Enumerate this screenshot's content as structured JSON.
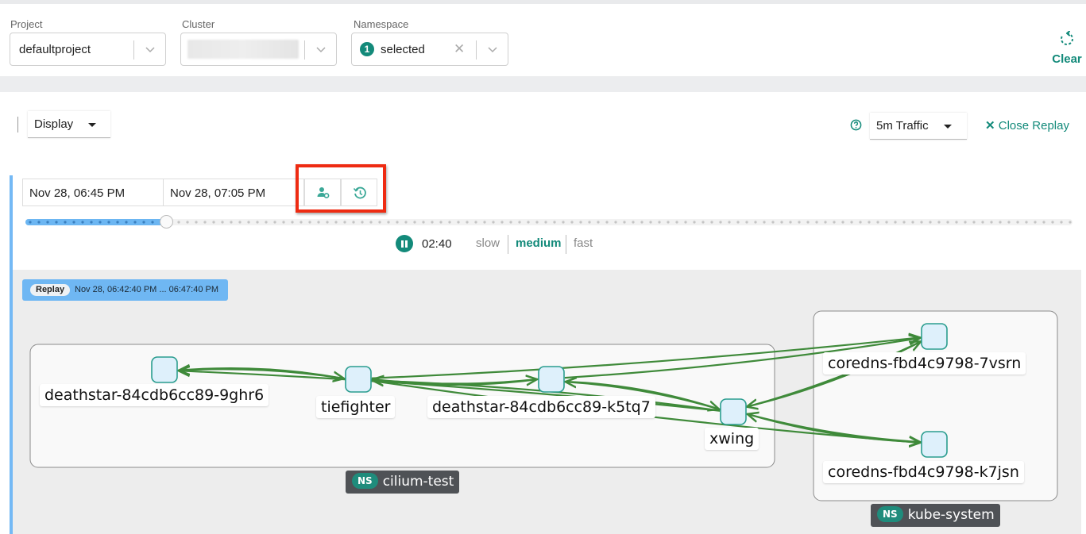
{
  "filters": {
    "project": {
      "label": "Project",
      "value": "defaultproject"
    },
    "cluster": {
      "label": "Cluster",
      "value": ""
    },
    "namespace": {
      "label": "Namespace",
      "count": "1",
      "value": "selected"
    },
    "clear_label": "Clear"
  },
  "toolbar": {
    "display_label": "Display",
    "traffic_label": "5m Traffic",
    "close_replay_label": "Close Replay",
    "close_replay_icon": "close-icon",
    "help_icon": "question-circle-icon"
  },
  "timeline": {
    "start": "Nov 28, 06:45 PM",
    "end": "Nov 28, 07:05 PM",
    "buttons": [
      {
        "name": "user-settings-icon"
      },
      {
        "name": "history-icon"
      }
    ],
    "progress": 0.134,
    "elapsed": "02:40",
    "speeds": [
      "slow",
      "medium",
      "fast"
    ],
    "active_speed": "medium",
    "accent": "#138a7a"
  },
  "replay": {
    "tag": "Replay",
    "range": "Nov 28, 06:42:40 PM ... 06:47:40 PM"
  },
  "graph": {
    "namespaces": [
      {
        "id": "cilium-test",
        "prefix": "NS",
        "label": "cilium-test"
      },
      {
        "id": "kube-system",
        "prefix": "NS",
        "label": "kube-system"
      }
    ],
    "nodes": [
      {
        "id": "ds9",
        "label": "deathstar-84cdb6cc89-9ghr6",
        "namespace": "cilium-test"
      },
      {
        "id": "tie",
        "label": "tiefighter",
        "namespace": "cilium-test"
      },
      {
        "id": "dsk",
        "label": "deathstar-84cdb6cc89-k5tq7",
        "namespace": "cilium-test"
      },
      {
        "id": "xw",
        "label": "xwing",
        "namespace": "cilium-test"
      },
      {
        "id": "c7v",
        "label": "coredns-fbd4c9798-7vsrn",
        "namespace": "kube-system"
      },
      {
        "id": "ck7",
        "label": "coredns-fbd4c9798-k7jsn",
        "namespace": "kube-system"
      }
    ],
    "edges": [
      {
        "from": "tie",
        "to": "ds9"
      },
      {
        "from": "ds9",
        "to": "tie"
      },
      {
        "from": "tie",
        "to": "dsk"
      },
      {
        "from": "dsk",
        "to": "tie"
      },
      {
        "from": "xw",
        "to": "ds9"
      },
      {
        "from": "xw",
        "to": "dsk"
      },
      {
        "from": "dsk",
        "to": "xw"
      },
      {
        "from": "xw",
        "to": "tie"
      },
      {
        "from": "tie",
        "to": "c7v"
      },
      {
        "from": "dsk",
        "to": "c7v"
      },
      {
        "from": "xw",
        "to": "c7v"
      },
      {
        "from": "c7v",
        "to": "xw"
      },
      {
        "from": "xw",
        "to": "ck7"
      },
      {
        "from": "ck7",
        "to": "xw"
      },
      {
        "from": "tie",
        "to": "ck7"
      }
    ],
    "edge_color": "#3f8a3a"
  }
}
